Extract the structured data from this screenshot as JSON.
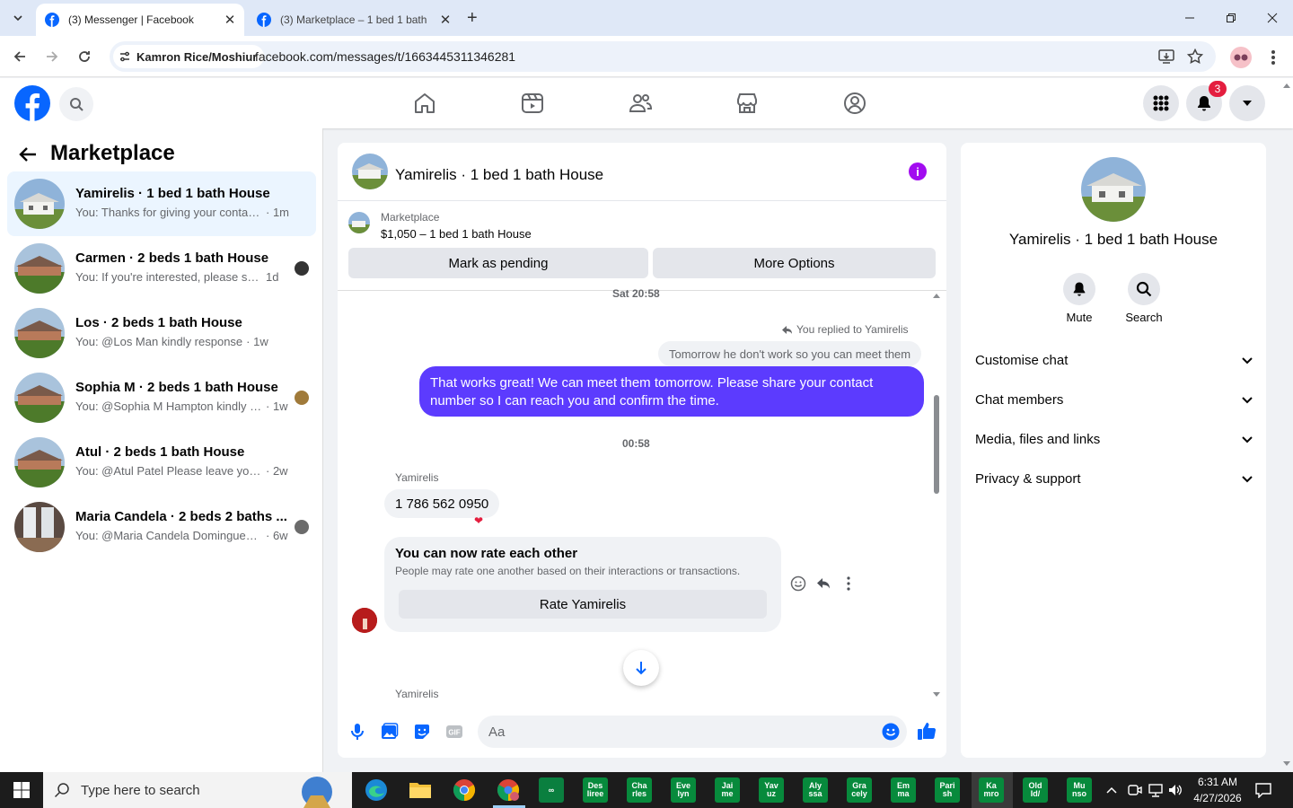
{
  "browser": {
    "tabs": [
      {
        "title": "(3) Messenger | Facebook",
        "active": true
      },
      {
        "title": "(3) Marketplace – 1 bed 1 bath",
        "active": false
      }
    ],
    "profile_chip": "Kamron Rice/Moshiur",
    "url": "facebook.com/messages/t/1663445311346281"
  },
  "facebook": {
    "notification_count": "3",
    "left_pane": {
      "title": "Marketplace",
      "conversations": [
        {
          "name": "Yamirelis · 1 bed 1 bath House",
          "preview": "You: Thanks for giving your contact i...",
          "time": "· 1m",
          "selected": true
        },
        {
          "name": "Carmen · 2 beds 1 bath House",
          "preview": "You: If you're interested, please sha...",
          "time": "1d",
          "selected": false
        },
        {
          "name": "Los · 2 beds 1 bath House",
          "preview": "You: @Los Man kindly response",
          "time": "· 1w",
          "selected": false
        },
        {
          "name": "Sophia M · 2 beds 1 bath House",
          "preview": "You: @Sophia M Hampton kindly s...",
          "time": "· 1w",
          "selected": false
        },
        {
          "name": "Atul · 2 beds 1 bath House",
          "preview": "You: @Atul Patel Please leave your nu...",
          "time": "· 2w",
          "selected": false
        },
        {
          "name": "Maria Candela · 2 beds 2 baths ...",
          "preview": "You: @Maria Candela Dominguez ...",
          "time": "· 6w",
          "selected": false
        }
      ]
    },
    "chat": {
      "title": "Yamirelis · 1 bed 1 bath House",
      "marketplace_label": "Marketplace",
      "listing": "$1,050 – 1 bed 1 bath House",
      "mark_pending": "Mark as pending",
      "more_options": "More Options",
      "timestamp1": "Sat 20:58",
      "replied_to": "You replied to Yamirelis",
      "quoted": "Tomorrow he don't work so you can meet them",
      "outgoing": "That works great! We can meet them tomorrow. Please share your contact number so I can reach you and confirm the time.",
      "timestamp2": "00:58",
      "sender": "Yamirelis",
      "incoming": "1 786 562 0950",
      "rate_title": "You can now rate each other",
      "rate_sub": "People may rate one another based on their interactions or transactions.",
      "rate_button": "Rate Yamirelis",
      "sender2": "Yamirelis",
      "composer_placeholder": "Aa"
    },
    "right_pane": {
      "name": "Yamirelis · 1 bed 1 bath House",
      "mute": "Mute",
      "search": "Search",
      "rows": [
        "Customise chat",
        "Chat members",
        "Media, files and links",
        "Privacy & support"
      ]
    }
  },
  "taskbar": {
    "search_placeholder": "Type here to search",
    "apps": [
      "Des\nliree",
      "Cha\nrles",
      "Eve\nlyn",
      "Jai\nme",
      "Yav\nuz",
      "Aly\nssa",
      "Gra\ncely",
      "Em\nma",
      "Pari\nsh",
      "Ka\nmro",
      "Old\nId/",
      "Mu\nnso"
    ],
    "time": "6:31 AM",
    "date": "4/27/2026"
  },
  "colors": {
    "fb_blue": "#0866ff",
    "outgoing_bubble": "#5c3bfe",
    "info_purple": "#a20cf0",
    "badge_red": "#e41e3f"
  }
}
